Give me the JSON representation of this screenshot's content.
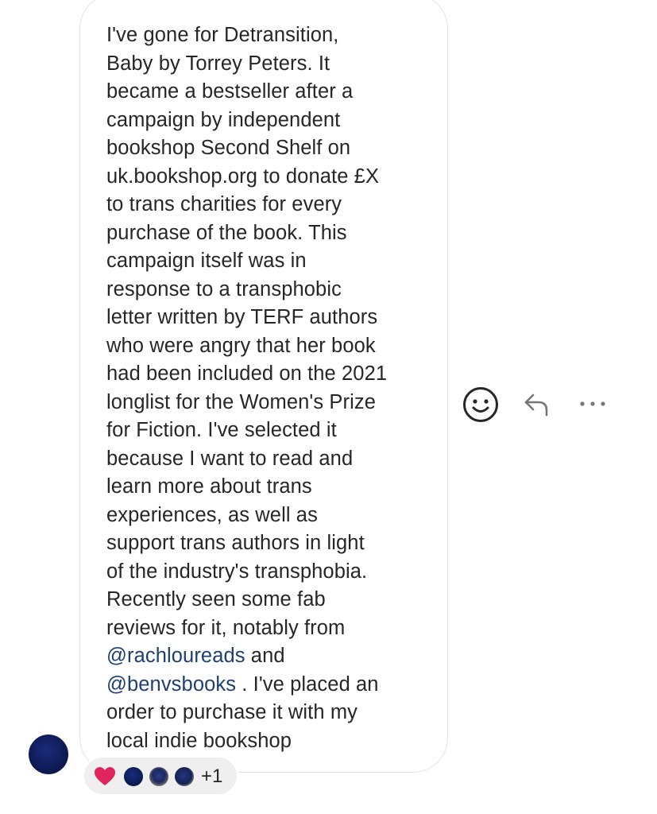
{
  "message": {
    "lines": [
      "I've gone for Detransition,",
      "Baby by Torrey Peters. It",
      "became a bestseller after a",
      "campaign by independent",
      "bookshop Second Shelf on",
      "uk.bookshop.org to donate £X",
      "to trans charities for every",
      "purchase of the book. This",
      "campaign itself was in",
      "response to a transphobic",
      "letter written by TERF authors",
      "who were angry that her book",
      "had been included on the 2021",
      "longlist for the Women's Prize",
      "for Fiction. I've selected it",
      "because I want to read and",
      "learn more about trans",
      "experiences, as well as",
      "support trans authors in light",
      "of the industry's transphobia.",
      "Recently seen some fab",
      "reviews for it, notably from"
    ],
    "mention_1": "@rachloureads",
    "mention_1_suffix": " and",
    "mention_2": "@benvsbooks",
    "mention_2_suffix": " . I've placed an",
    "tail_lines": [
      "order to purchase it with my",
      "local indie bookshop"
    ]
  },
  "actions": {
    "react_icon": "smiley-icon",
    "reply_icon": "reply-arrow-icon",
    "more_icon": "more-dots-icon"
  },
  "reactions": {
    "emoji_icon": "heart-icon",
    "extra_count": "+1"
  },
  "colors": {
    "text": "#262626",
    "mention": "#1e3f73",
    "bubble_border": "#e3e3e3",
    "reaction_bg": "#efefef",
    "heart": "#e0245e"
  }
}
